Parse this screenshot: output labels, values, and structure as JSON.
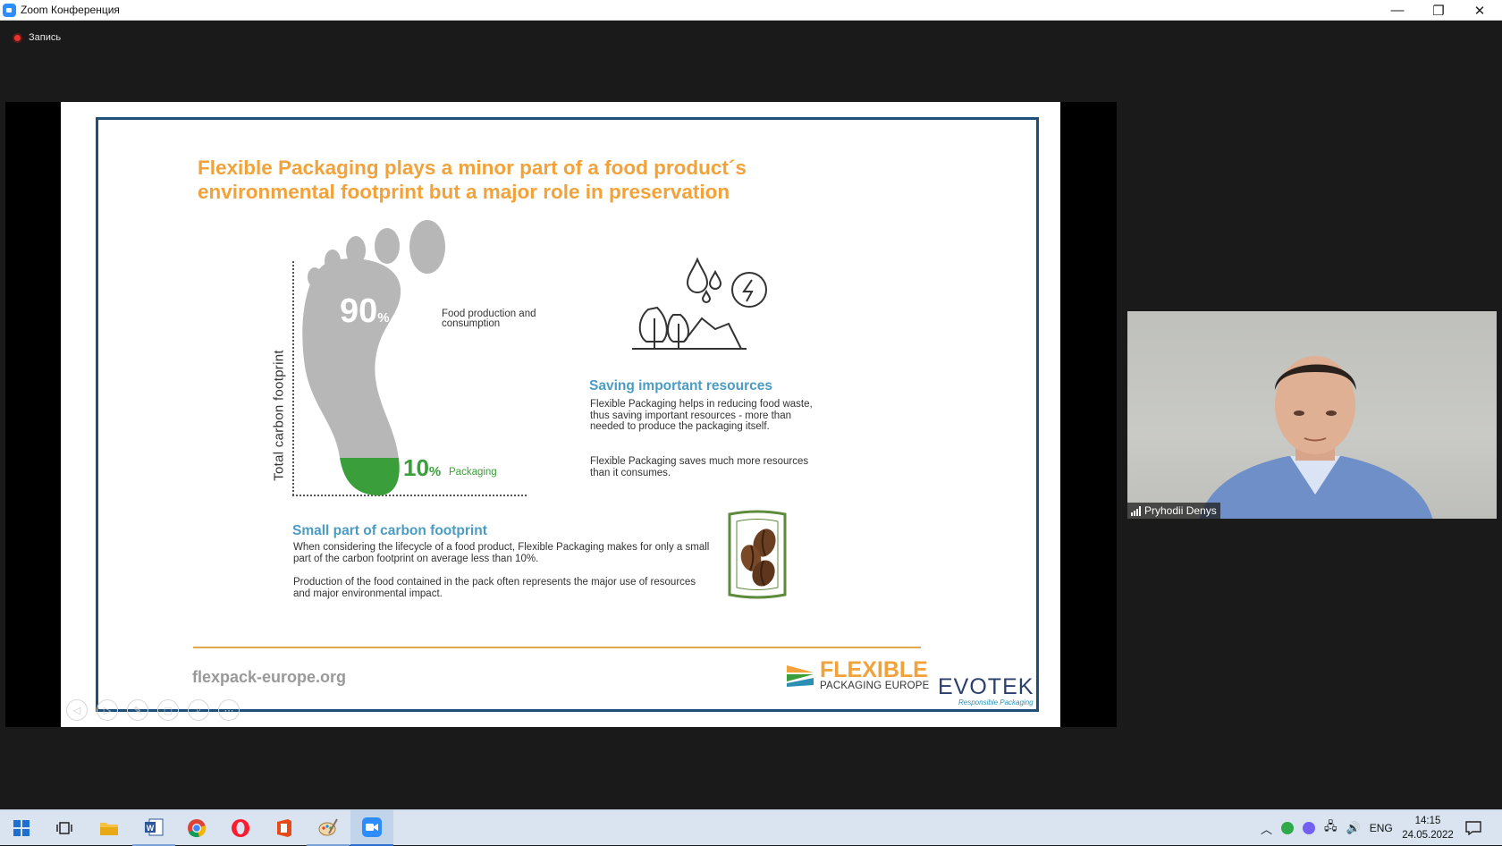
{
  "window": {
    "title": "Zoom Конференция",
    "minimize": "—",
    "maximize": "❐",
    "close": "✕"
  },
  "recording": {
    "label": "Запись"
  },
  "slide": {
    "title": "Flexible Packaging plays a minor part of a food product´s environmental footprint but a major role in preservation",
    "axis_label": "Total carbon footprint",
    "pct_food": "90",
    "pct_food_unit": "%",
    "label_food": "Food production and consumption",
    "pct_pack": "10",
    "pct_pack_unit": "%",
    "label_pack": "Packaging",
    "saving_heading": "Saving important resources",
    "saving_p1": "Flexible Packaging helps in reducing food waste, thus saving important resources - more than needed to produce the packaging itself.",
    "saving_p2": "Flexible Packaging saves much more resources than it consumes.",
    "small_heading": "Small part of carbon footprint",
    "small_p1": "When considering the lifecycle of a food product, Flexible Packaging makes for only a small part of the carbon footprint on average less than 10%.",
    "small_p2": "Production of the food contained in the pack often represents the major use of resources and major environmental impact.",
    "footer_url": "flexpack-europe.org",
    "logo_flexible": "FLEXIBLE",
    "logo_pe": "PACKAGING EUROPE",
    "logo_evotek": "EVOTEK",
    "logo_evotek_sub": "Responsible Packaging"
  },
  "participant": {
    "name": "Pryhodii Denys"
  },
  "taskbar": {
    "lang": "ENG",
    "time": "14:15",
    "date": "24.05.2022"
  },
  "colors": {
    "accent_orange": "#f2a23a",
    "accent_blue": "#4b9cc4",
    "accent_green": "#3a9e3a",
    "frame_blue": "#1f4e79"
  }
}
